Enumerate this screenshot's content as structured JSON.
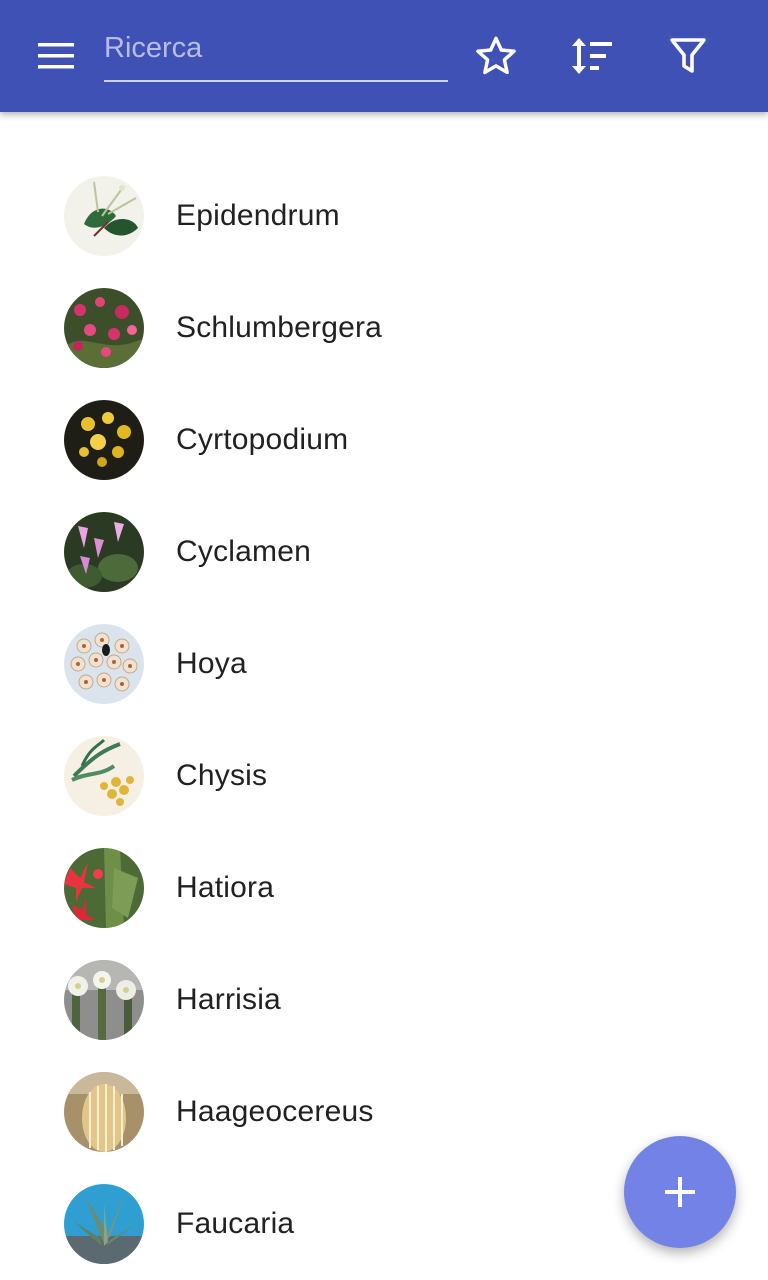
{
  "toolbar": {
    "background": "#3f51b5",
    "menu_icon": "menu-icon",
    "search_placeholder": "Ricerca",
    "search_value": "",
    "favorites_icon": "star-outline-icon",
    "sort_icon": "sort-icon",
    "filter_icon": "filter-icon"
  },
  "plants": [
    {
      "name": "Epidendrum"
    },
    {
      "name": "Schlumbergera"
    },
    {
      "name": "Cyrtopodium"
    },
    {
      "name": "Cyclamen"
    },
    {
      "name": "Hoya"
    },
    {
      "name": "Chysis"
    },
    {
      "name": "Hatiora"
    },
    {
      "name": "Harrisia"
    },
    {
      "name": "Haageocereus"
    },
    {
      "name": "Faucaria"
    }
  ],
  "fab": {
    "icon": "plus-icon",
    "color": "#7382e6"
  }
}
